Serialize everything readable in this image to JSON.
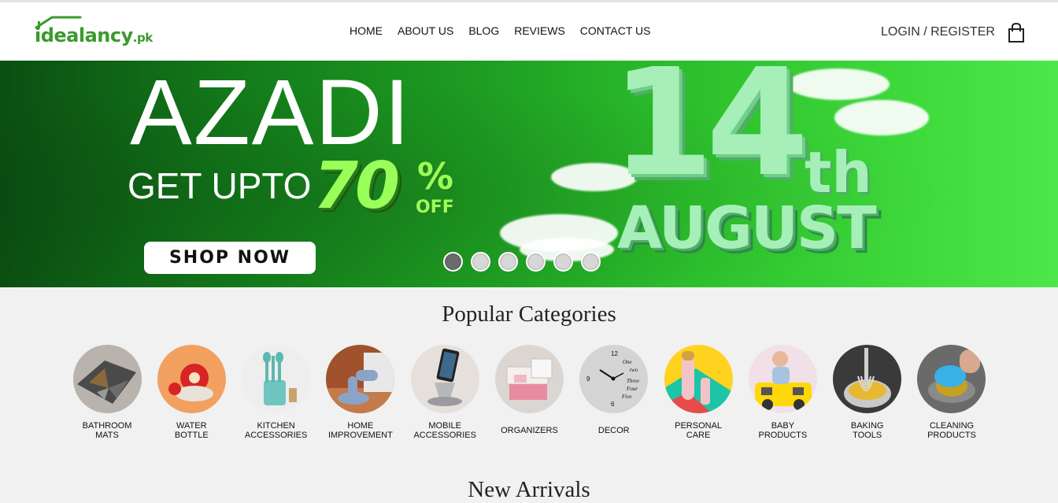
{
  "brand": {
    "name": "idealancy",
    "tld": ".pk",
    "color": "#3a9a2c"
  },
  "nav": {
    "items": [
      {
        "label": "HOME"
      },
      {
        "label": "ABOUT US"
      },
      {
        "label": "BLOG"
      },
      {
        "label": "REVIEWS"
      },
      {
        "label": "CONTACT US"
      }
    ],
    "login_label": "LOGIN / REGISTER",
    "cart_icon": "shopping-bag-icon"
  },
  "hero": {
    "headline": "AZADI",
    "offer_prefix": "GET UPTO",
    "offer_value": "70",
    "offer_percent": "%",
    "offer_suffix": "OFF",
    "button_label": "SHOP NOW",
    "date_number": "14",
    "date_suffix": "th",
    "date_month": "AUGUST",
    "slide_count": 6,
    "active_slide": 1
  },
  "popular_categories": {
    "title": "Popular Categories",
    "items": [
      {
        "label": "BATHROOM\nMATS",
        "icon": "bathroom-mat-icon"
      },
      {
        "label": "WATER\nBOTTLE",
        "icon": "water-bottle-icon"
      },
      {
        "label": "KITCHEN\nACCESSORIES",
        "icon": "kitchen-utensils-icon"
      },
      {
        "label": "HOME\nIMPROVEMENT",
        "icon": "door-stopper-icon"
      },
      {
        "label": "MOBILE\nACCESSORIES",
        "icon": "phone-stand-icon"
      },
      {
        "label": "ORGANIZERS",
        "icon": "organizer-box-icon"
      },
      {
        "label": "DECOR",
        "icon": "wall-clock-icon"
      },
      {
        "label": "PERSONAL\nCARE",
        "icon": "trimmer-icon"
      },
      {
        "label": "BABY\nPRODUCTS",
        "icon": "baby-toy-icon"
      },
      {
        "label": "BAKING\nTOOLS",
        "icon": "whisk-icon"
      },
      {
        "label": "CLEANING\nPRODUCTS",
        "icon": "scrubber-icon"
      }
    ]
  },
  "new_arrivals": {
    "title": "New Arrivals"
  }
}
